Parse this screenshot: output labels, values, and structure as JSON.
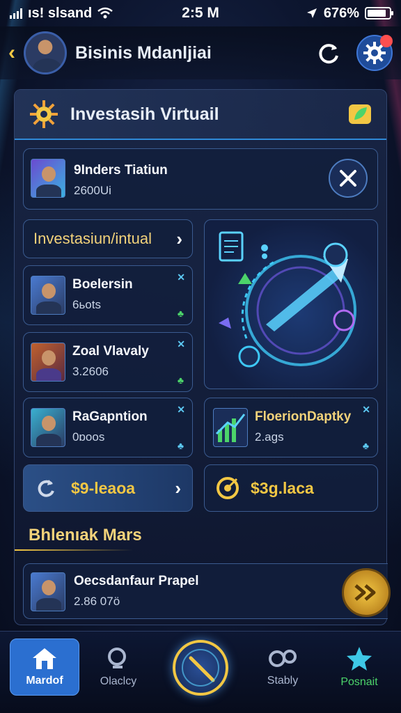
{
  "status_bar": {
    "carrier": "ıs! slsand",
    "time": "2:5 M",
    "battery": "676%",
    "battery_level": 0.85
  },
  "header": {
    "title": "Bisinis Mdanljiai",
    "notification_count": ""
  },
  "card": {
    "title": "Investasih Virtuail",
    "featured": {
      "name": "9Inders Tiatiun",
      "value": "2600Ui"
    },
    "section_label": "Investasiun/intual",
    "rows": [
      {
        "name": "Boelersin",
        "value": "6ьots"
      },
      {
        "name": "Zoal Vlavaly",
        "value": "3.2606"
      },
      {
        "name": "RaGapntion",
        "value": "0ɒoos"
      }
    ],
    "side_item": {
      "name": "FloerionDaptky",
      "value": "2.ags"
    },
    "amount_left": "$9-leaoa",
    "amount_right": "$3g.laca",
    "subtitle": "Bhlenıak Mars",
    "bottom_row": {
      "name": "Oecsdanfaur Prapel",
      "value": "2.86 07ö"
    }
  },
  "nav": [
    {
      "label": "Mardof"
    },
    {
      "label": "Olaclcy"
    },
    {
      "label": ""
    },
    {
      "label": "Stably"
    },
    {
      "label": "Posnait"
    }
  ],
  "colors": {
    "accent_gold": "#f2c744",
    "accent_blue": "#2b6fd0",
    "accent_green": "#4cd46a"
  }
}
